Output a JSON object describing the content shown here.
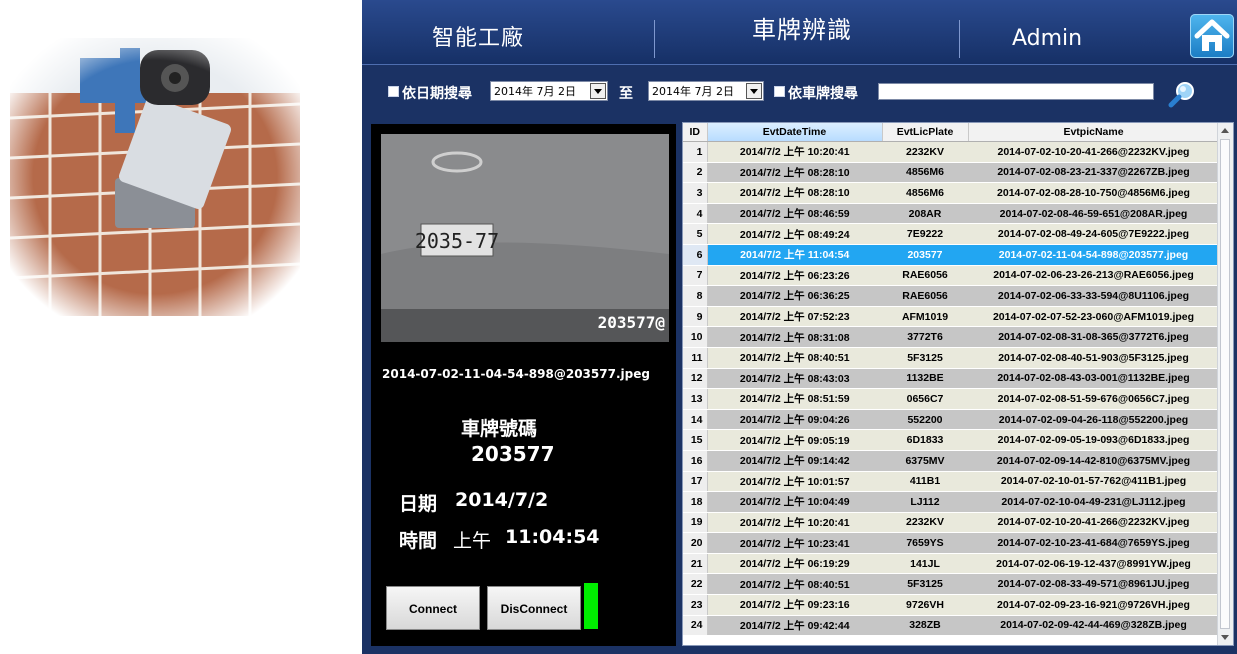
{
  "header": {
    "app_title": "智能工廠",
    "page_title": "車牌辨識",
    "user": "Admin"
  },
  "search": {
    "date_search_label": "依日期搜尋",
    "date_from": "2014年 7月 2日",
    "to_label": "至",
    "date_to": "2014年 7月 2日",
    "plate_search_label": "依車牌搜尋",
    "plate_query": ""
  },
  "detail": {
    "photo_overlay_text": "203577@",
    "photo_plate_text": "2035-77",
    "filename": "2014-07-02-11-04-54-898@203577.jpeg",
    "plate_label": "車牌號碼",
    "plate_value": "203577",
    "date_label": "日期",
    "date_value": "2014/7/2",
    "time_label": "時間",
    "time_ampm": "上午",
    "time_value": "11:04:54",
    "connect_label": "Connect",
    "disconnect_label": "DisConnect",
    "status_color": "#00ee00"
  },
  "table": {
    "columns": [
      "ID",
      "EvtDateTime",
      "EvtLicPlate",
      "EvtpicName"
    ],
    "selected_row": 6,
    "rows": [
      [
        "1",
        "2014/7/2 上午 10:20:41",
        "2232KV",
        "2014-07-02-10-20-41-266@2232KV.jpeg"
      ],
      [
        "2",
        "2014/7/2 上午 08:28:10",
        "4856M6",
        "2014-07-02-08-23-21-337@2267ZB.jpeg"
      ],
      [
        "3",
        "2014/7/2 上午 08:28:10",
        "4856M6",
        "2014-07-02-08-28-10-750@4856M6.jpeg"
      ],
      [
        "4",
        "2014/7/2 上午 08:46:59",
        "208AR",
        "2014-07-02-08-46-59-651@208AR.jpeg"
      ],
      [
        "5",
        "2014/7/2 上午 08:49:24",
        "7E9222",
        "2014-07-02-08-49-24-605@7E9222.jpeg"
      ],
      [
        "6",
        "2014/7/2 上午 11:04:54",
        "203577",
        "2014-07-02-11-04-54-898@203577.jpeg"
      ],
      [
        "7",
        "2014/7/2 上午 06:23:26",
        "RAE6056",
        "2014-07-02-06-23-26-213@RAE6056.jpeg"
      ],
      [
        "8",
        "2014/7/2 上午 06:36:25",
        "RAE6056",
        "2014-07-02-06-33-33-594@8U1106.jpeg"
      ],
      [
        "9",
        "2014/7/2 上午 07:52:23",
        "AFM1019",
        "2014-07-02-07-52-23-060@AFM1019.jpeg"
      ],
      [
        "10",
        "2014/7/2 上午 08:31:08",
        "3772T6",
        "2014-07-02-08-31-08-365@3772T6.jpeg"
      ],
      [
        "11",
        "2014/7/2 上午 08:40:51",
        "5F3125",
        "2014-07-02-08-40-51-903@5F3125.jpeg"
      ],
      [
        "12",
        "2014/7/2 上午 08:43:03",
        "1132BE",
        "2014-07-02-08-43-03-001@1132BE.jpeg"
      ],
      [
        "13",
        "2014/7/2 上午 08:51:59",
        "0656C7",
        "2014-07-02-08-51-59-676@0656C7.jpeg"
      ],
      [
        "14",
        "2014/7/2 上午 09:04:26",
        "552200",
        "2014-07-02-09-04-26-118@552200.jpeg"
      ],
      [
        "15",
        "2014/7/2 上午 09:05:19",
        "6D1833",
        "2014-07-02-09-05-19-093@6D1833.jpeg"
      ],
      [
        "16",
        "2014/7/2 上午 09:14:42",
        "6375MV",
        "2014-07-02-09-14-42-810@6375MV.jpeg"
      ],
      [
        "17",
        "2014/7/2 上午 10:01:57",
        "411B1",
        "2014-07-02-10-01-57-762@411B1.jpeg"
      ],
      [
        "18",
        "2014/7/2 上午 10:04:49",
        "LJ112",
        "2014-07-02-10-04-49-231@LJ112.jpeg"
      ],
      [
        "19",
        "2014/7/2 上午 10:20:41",
        "2232KV",
        "2014-07-02-10-20-41-266@2232KV.jpeg"
      ],
      [
        "20",
        "2014/7/2 上午 10:23:41",
        "7659YS",
        "2014-07-02-10-23-41-684@7659YS.jpeg"
      ],
      [
        "21",
        "2014/7/2 上午 06:19:29",
        "141JL",
        "2014-07-02-06-19-12-437@8991YW.jpeg"
      ],
      [
        "22",
        "2014/7/2 上午 08:40:51",
        "5F3125",
        "2014-07-02-08-33-49-571@8961JU.jpeg"
      ],
      [
        "23",
        "2014/7/2 上午 09:23:16",
        "9726VH",
        "2014-07-02-09-23-16-921@9726VH.jpeg"
      ],
      [
        "24",
        "2014/7/2 上午 09:42:44",
        "328ZB",
        "2014-07-02-09-42-44-469@328ZB.jpeg"
      ]
    ]
  },
  "colors": {
    "app_bg": "#1b3264",
    "selected_row": "#22a6f2",
    "row_alt": "#c6c6c6",
    "row_norm": "#e9e9dc"
  }
}
